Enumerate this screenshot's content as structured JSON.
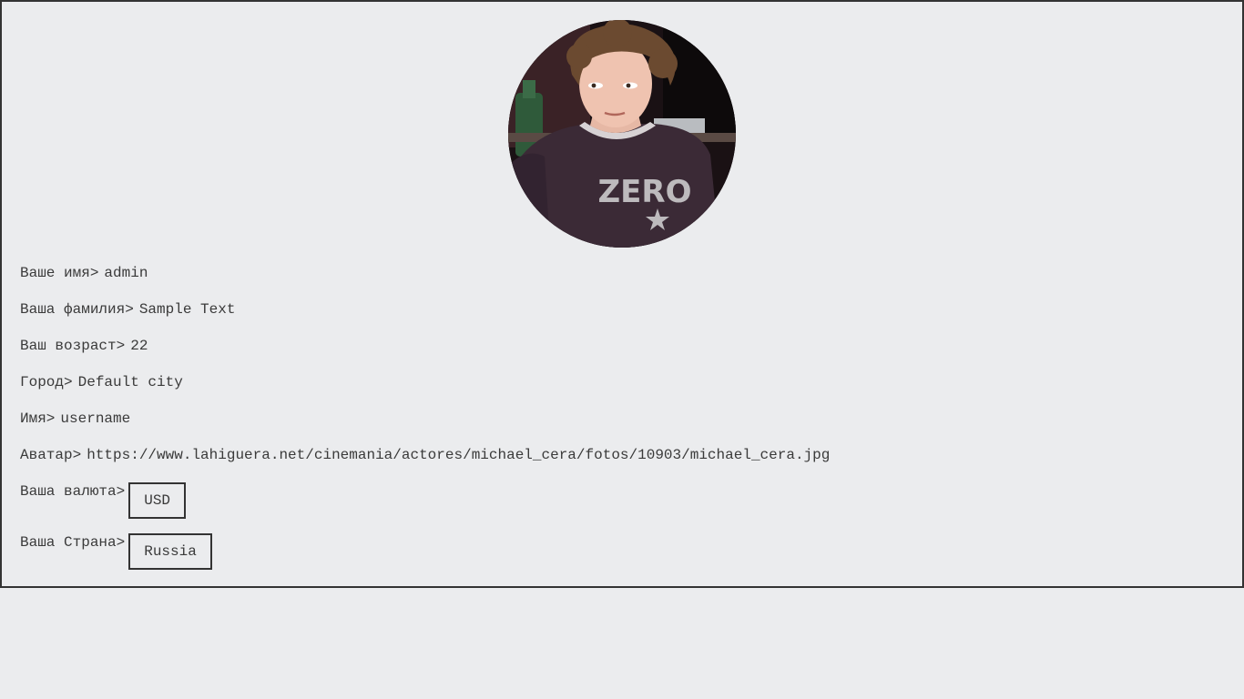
{
  "avatar": {
    "icon": "avatar-photo",
    "shirt_text": "ZERO"
  },
  "fields": {
    "first_name": {
      "label": "Ваше имя>",
      "value": "admin"
    },
    "last_name": {
      "label": "Ваша фамилия>",
      "value": "Sample Text"
    },
    "age": {
      "label": "Ваш возраст>",
      "value": "22"
    },
    "city": {
      "label": "Город>",
      "value": "Default city"
    },
    "username": {
      "label": "Имя>",
      "value": "username"
    },
    "avatar_url": {
      "label": "Аватар>",
      "value": "https://www.lahiguera.net/cinemania/actores/michael_cera/fotos/10903/michael_cera.jpg"
    },
    "currency": {
      "label": "Ваша валюта>",
      "value": "USD"
    },
    "country": {
      "label": "Ваша Страна>",
      "value": "Russia"
    }
  },
  "colors": {
    "background": "#ebecee",
    "border": "#333333",
    "text": "#3a3a3a"
  }
}
